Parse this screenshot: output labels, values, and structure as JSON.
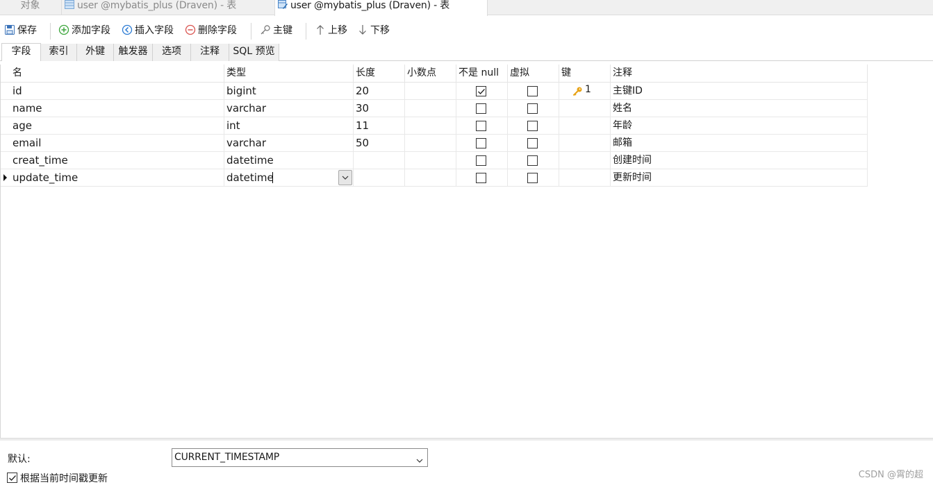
{
  "doc_tabs": [
    {
      "label": "对象"
    },
    {
      "label": "user @mybatis_plus (Draven) - 表"
    },
    {
      "label": "user @mybatis_plus (Draven) - 表"
    }
  ],
  "toolbar": {
    "save": "保存",
    "add_field": "添加字段",
    "insert_field": "插入字段",
    "delete_field": "删除字段",
    "primary_key": "主键",
    "move_up": "上移",
    "move_down": "下移"
  },
  "sub_tabs": [
    "字段",
    "索引",
    "外键",
    "触发器",
    "选项",
    "注释",
    "SQL 预览"
  ],
  "columns": [
    "名",
    "类型",
    "长度",
    "小数点",
    "不是 null",
    "虚拟",
    "键",
    "注释"
  ],
  "rows": [
    {
      "name": "id",
      "type": "bigint",
      "length": "20",
      "decimals": "",
      "not_null": true,
      "virtual": false,
      "key": "1",
      "comment": "主键ID"
    },
    {
      "name": "name",
      "type": "varchar",
      "length": "30",
      "decimals": "",
      "not_null": false,
      "virtual": false,
      "key": "",
      "comment": "姓名"
    },
    {
      "name": "age",
      "type": "int",
      "length": "11",
      "decimals": "",
      "not_null": false,
      "virtual": false,
      "key": "",
      "comment": "年龄"
    },
    {
      "name": "email",
      "type": "varchar",
      "length": "50",
      "decimals": "",
      "not_null": false,
      "virtual": false,
      "key": "",
      "comment": "邮箱"
    },
    {
      "name": "creat_time",
      "type": "datetime",
      "length": "",
      "decimals": "",
      "not_null": false,
      "virtual": false,
      "key": "",
      "comment": "创建时间"
    },
    {
      "name": "update_time",
      "type": "datetime",
      "length": "",
      "decimals": "",
      "not_null": false,
      "virtual": false,
      "key": "",
      "comment": "更新时间"
    }
  ],
  "bottom": {
    "default_label": "默认:",
    "default_value": "CURRENT_TIMESTAMP",
    "on_update_label": "根据当前时间戳更新",
    "on_update_checked": true
  },
  "watermark": "CSDN @霄的超",
  "colors": {
    "key_icon": "#e8a317",
    "add_icon": "#3aa53a",
    "insert_icon": "#2b7bd4",
    "delete_icon": "#d9534f"
  }
}
